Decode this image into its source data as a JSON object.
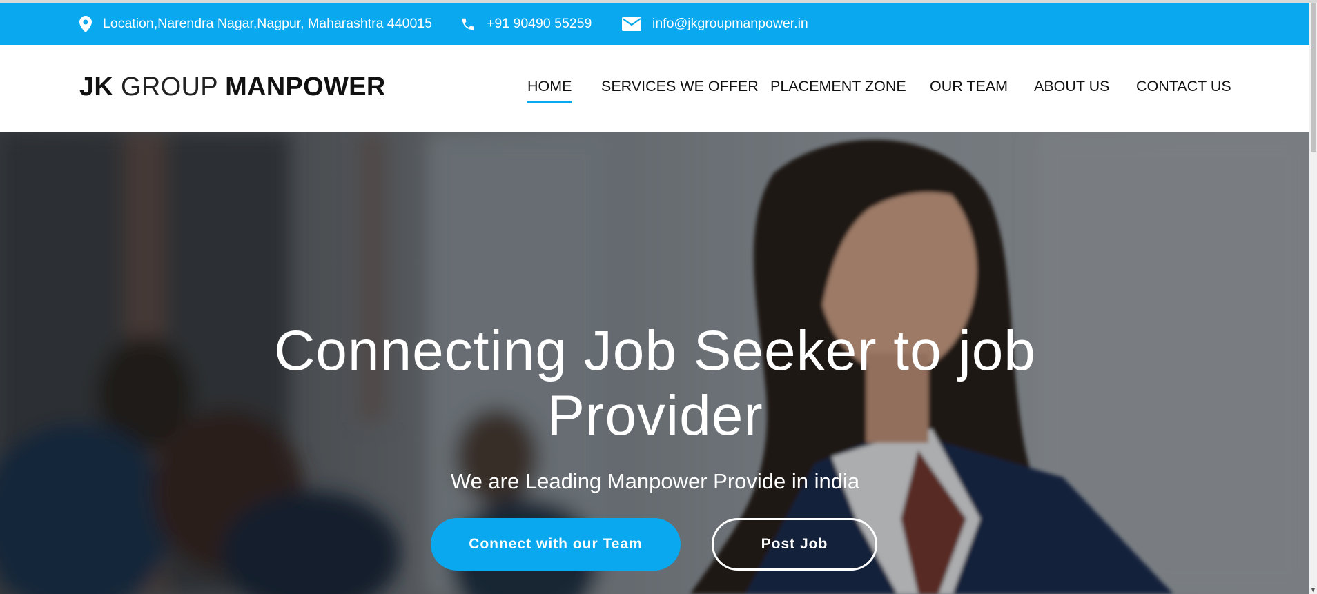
{
  "topbar": {
    "location": "Location,Narendra Nagar,Nagpur, Maharashtra 440015",
    "phone": "+91 90490 55259",
    "email": "info@jkgroupmanpower.in",
    "icons": [
      "map-pin-icon",
      "phone-icon",
      "envelope-icon"
    ],
    "color": "#0aa8ef"
  },
  "header": {
    "logo_part1": "JK",
    "logo_part2": "GROUP",
    "logo_part3": "MANPOWER",
    "nav": [
      {
        "label": "HOME",
        "active": true
      },
      {
        "label": "SERVICES WE OFFER"
      },
      {
        "label": "PLACEMENT ZONE"
      },
      {
        "label": "OUR TEAM"
      },
      {
        "label": "ABOUT US"
      },
      {
        "label": "CONTACT US"
      }
    ]
  },
  "hero": {
    "title_line1": "Connecting Job Seeker to job",
    "title_line2": "Provider",
    "subtitle": "We are Leading Manpower Provide in india",
    "primary_button": "Connect with our Team",
    "secondary_button": "Post Job"
  },
  "colors": {
    "accent": "#0aa8ef",
    "text_dark": "#111111"
  }
}
